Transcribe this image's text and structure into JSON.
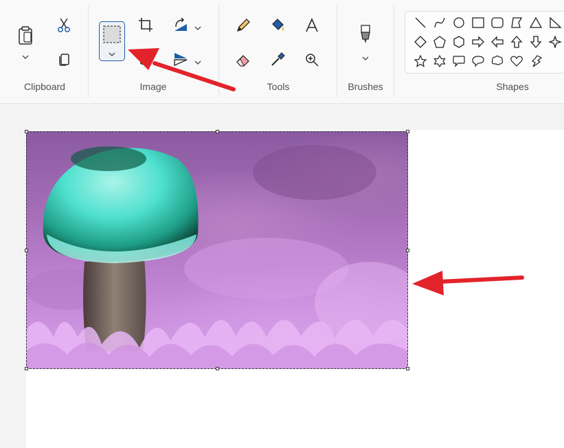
{
  "ribbon": {
    "groups": {
      "clipboard": "Clipboard",
      "image": "Image",
      "tools": "Tools",
      "brushes": "Brushes",
      "shapes": "Shapes"
    }
  },
  "icons": {
    "paste": "paste-icon",
    "cut": "scissors-icon",
    "copy": "copy-icon",
    "select": "rectangle-select-icon",
    "crop": "crop-icon",
    "rotate": "rotate-icon",
    "flip": "flip-icon",
    "pencil": "pencil-icon",
    "fill": "fill-bucket-icon",
    "text": "text-icon",
    "eraser": "eraser-icon",
    "color_picker": "color-picker-icon",
    "magnifier": "magnifier-icon",
    "brush": "brush-icon"
  },
  "colors": {
    "accent": "#1a5fa8",
    "annotation_arrow": "#e3232b"
  }
}
